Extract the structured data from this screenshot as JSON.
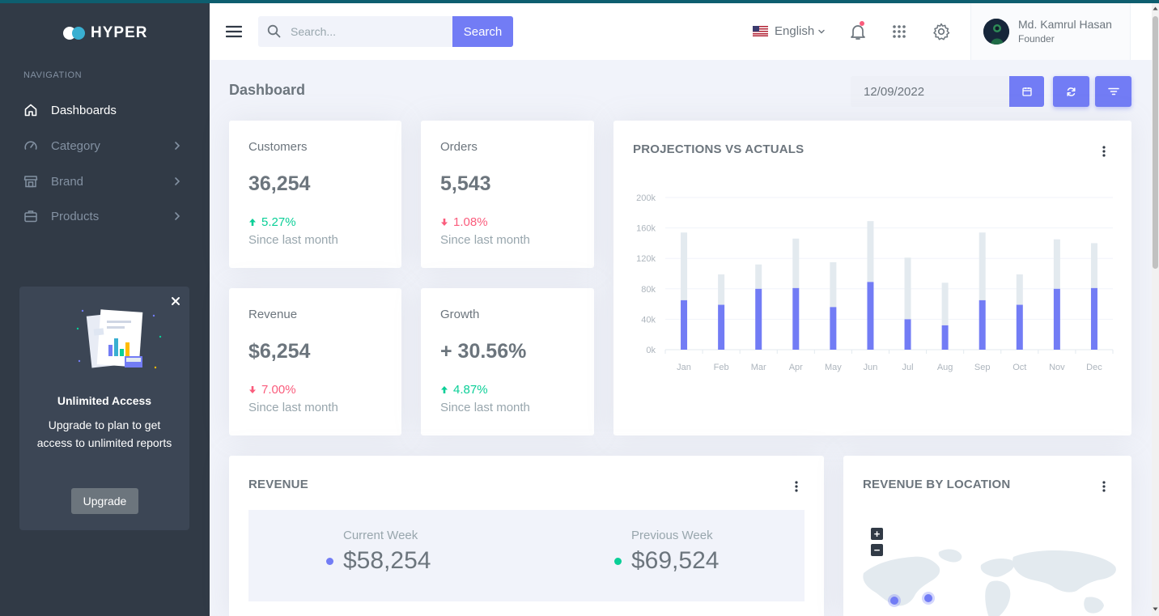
{
  "brand": {
    "name": "HYPER"
  },
  "sidebar": {
    "nav_title": "NAVIGATION",
    "items": [
      {
        "label": "Dashboards",
        "icon": "home-icon",
        "active": true
      },
      {
        "label": "Category",
        "icon": "speedometer-icon"
      },
      {
        "label": "Brand",
        "icon": "store-icon"
      },
      {
        "label": "Products",
        "icon": "briefcase-icon"
      }
    ],
    "upgrade": {
      "title": "Unlimited Access",
      "text": "Upgrade to plan to get access to unlimited reports",
      "button": "Upgrade"
    }
  },
  "topbar": {
    "search_placeholder": "Search...",
    "search_button": "Search",
    "language": "English",
    "user": {
      "name": "Md. Kamrul Hasan",
      "role": "Founder"
    }
  },
  "page": {
    "title": "Dashboard",
    "date": "12/09/2022"
  },
  "stats": [
    {
      "label": "Customers",
      "value": "36,254",
      "change": "5.27%",
      "direction": "up",
      "since": "Since last month"
    },
    {
      "label": "Orders",
      "value": "5,543",
      "change": "1.08%",
      "direction": "down",
      "since": "Since last month"
    },
    {
      "label": "Revenue",
      "value": "$6,254",
      "change": "7.00%",
      "direction": "down",
      "since": "Since last month"
    },
    {
      "label": "Growth",
      "value": "+ 30.56%",
      "change": "4.87%",
      "direction": "up",
      "since": "Since last month"
    }
  ],
  "projections_card": {
    "title": "PROJECTIONS VS ACTUALS"
  },
  "revenue_card": {
    "title": "REVENUE",
    "current_week_label": "Current Week",
    "current_week_value": "$58,254",
    "previous_week_label": "Previous Week",
    "previous_week_value": "$69,524"
  },
  "location_card": {
    "title": "REVENUE BY LOCATION",
    "zoom_in": "+",
    "zoom_out": "−"
  },
  "colors": {
    "primary": "#727cf5",
    "success": "#0acf97",
    "danger": "#fa5c7c",
    "sidebar": "#313a46",
    "projection_bar": "#e3eaef"
  },
  "chart_data": {
    "type": "bar",
    "stacked": true,
    "title": "PROJECTIONS VS ACTUALS",
    "categories": [
      "Jan",
      "Feb",
      "Mar",
      "Apr",
      "May",
      "Jun",
      "Jul",
      "Aug",
      "Sep",
      "Oct",
      "Nov",
      "Dec"
    ],
    "series": [
      {
        "values": [
          65,
          59,
          80,
          81,
          56,
          89,
          40,
          32,
          65,
          59,
          80,
          81
        ]
      },
      {
        "values": [
          89,
          40,
          32,
          65,
          59,
          80,
          81,
          56,
          89,
          40,
          65,
          59
        ]
      }
    ],
    "y_ticks": [
      "0k",
      "40k",
      "80k",
      "120k",
      "160k",
      "200k"
    ],
    "ylim": [
      0,
      200
    ],
    "grid": true,
    "legend": "none"
  }
}
